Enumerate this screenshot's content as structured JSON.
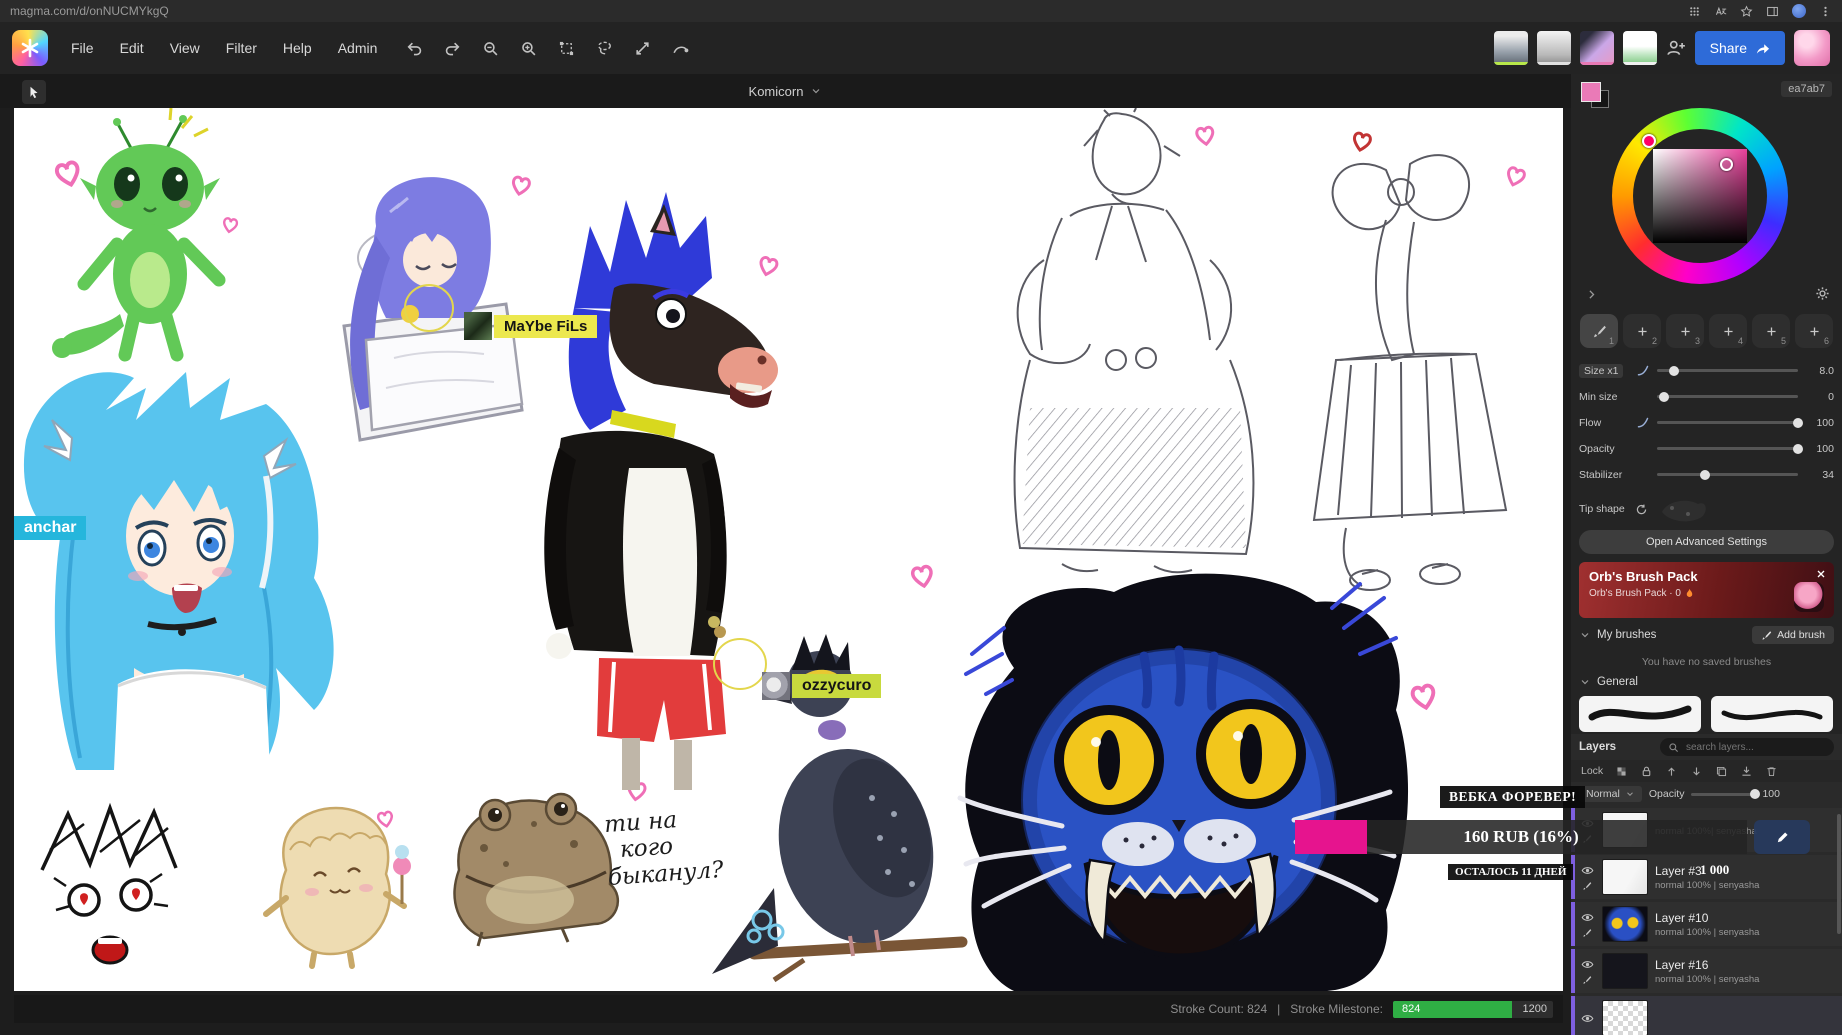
{
  "browser": {
    "url": "magma.com/d/onNUCMYkgQ"
  },
  "menu": {
    "items": [
      "File",
      "Edit",
      "View",
      "Filter",
      "Help",
      "Admin"
    ]
  },
  "header": {
    "title": "Komicorn"
  },
  "share": {
    "label": "Share"
  },
  "color": {
    "hex": "ea7ab7"
  },
  "brush": {
    "slots": [
      "1",
      "2",
      "3",
      "4",
      "5",
      "6"
    ],
    "sliders": [
      {
        "label": "Size x1",
        "value": "8.0",
        "pct": 12
      },
      {
        "label": "Min size",
        "value": "0",
        "pct": 5
      },
      {
        "label": "Flow",
        "value": "100",
        "pct": 100
      },
      {
        "label": "Opacity",
        "value": "100",
        "pct": 100
      },
      {
        "label": "Stabilizer",
        "value": "34",
        "pct": 34
      }
    ],
    "tip_shape_label": "Tip shape",
    "advanced_label": "Open Advanced Settings",
    "pack_title": "Orb's Brush Pack",
    "pack_subtitle": "Orb's Brush Pack · 0",
    "my_brushes_label": "My brushes",
    "add_brush_label": "Add brush",
    "empty_text": "You have no saved brushes",
    "general_label": "General"
  },
  "layers": {
    "title": "Layers",
    "search_placeholder": "search layers...",
    "lock_label": "Lock",
    "blend_mode": "Normal",
    "opacity_label": "Opacity",
    "opacity_value": "100",
    "opacity_pct": 100,
    "rows": [
      {
        "name": "",
        "meta": "normal 100%| senyasha"
      },
      {
        "name": "Layer #3",
        "meta": "normal 100% | senyasha"
      },
      {
        "name": "Layer #10",
        "meta": "normal 100% | senyasha"
      },
      {
        "name": "Layer #16",
        "meta": "normal 100% | senyasha"
      }
    ]
  },
  "donation": {
    "title": "ВЕБКА ФОРЕВЕР!",
    "amount": "160 RUB (16%)",
    "pct": 16,
    "days": "ОСТАЛОСЬ 11 ДНЕЙ",
    "goal": "1 000"
  },
  "status": {
    "count": "Stroke Count: 824",
    "sep": "|",
    "milestone": "Stroke Milestone:",
    "current": "824",
    "target": "1200",
    "pct": 69
  },
  "tags": {
    "anchar": "anchar",
    "maybe": "MaYbe FiLs",
    "ozzy": "ozzycuro"
  },
  "handwriting": {
    "l1": "ти на",
    "l2": "кого",
    "l3": "быканул?"
  }
}
